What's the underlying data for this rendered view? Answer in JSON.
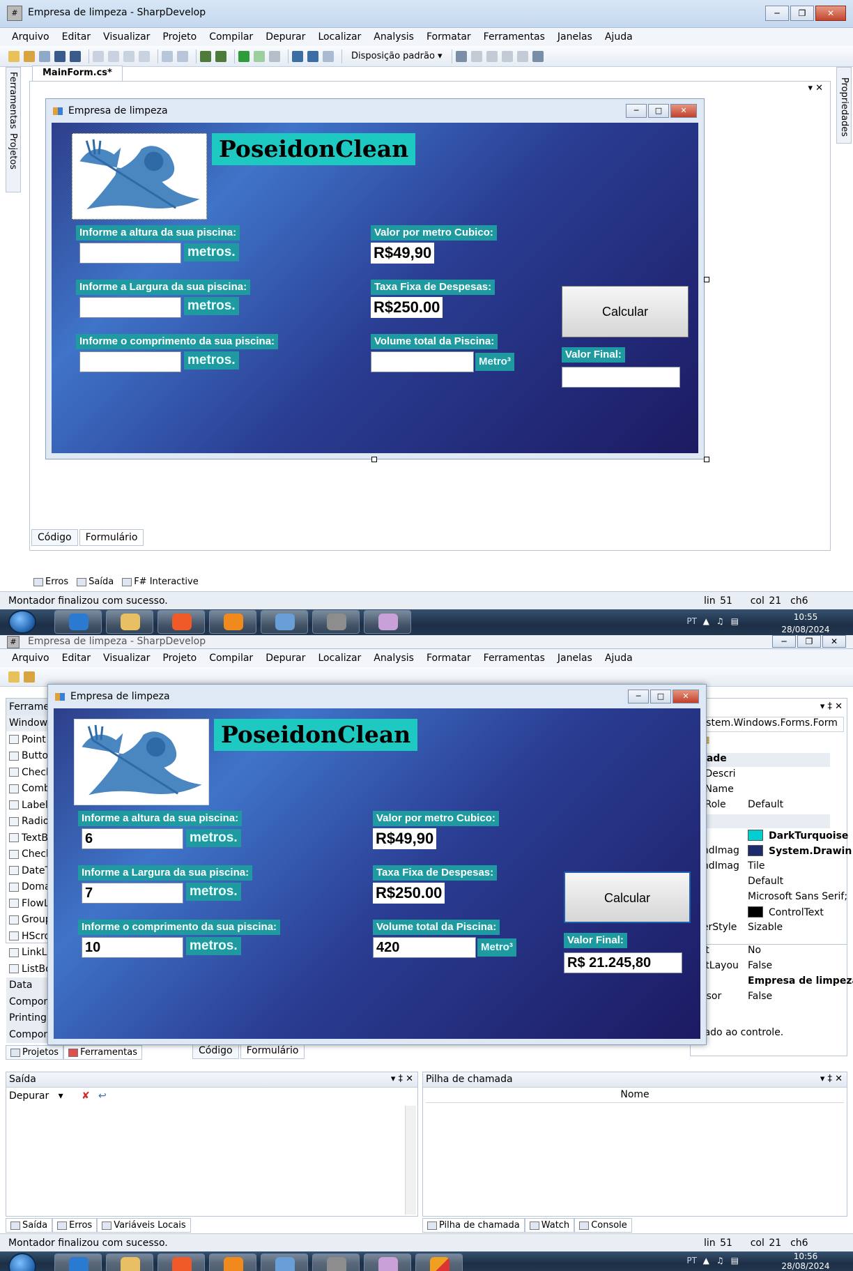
{
  "shot1": {
    "window": {
      "title": "Empresa de limpeza - SharpDevelop",
      "buttons": [
        "minimize",
        "restore",
        "close"
      ]
    },
    "menu": [
      "Arquivo",
      "Editar",
      "Visualizar",
      "Projeto",
      "Compilar",
      "Depurar",
      "Localizar",
      "Analysis",
      "Formatar",
      "Ferramentas",
      "Janelas",
      "Ajuda"
    ],
    "toolbar": {
      "layout_dropdown": "Disposição padrão"
    },
    "side_left": [
      "Ferramentas",
      "Projetos"
    ],
    "side_right": "Propriedades",
    "doc_tab": "MainForm.cs*",
    "designer_tabs": [
      "Código",
      "Formulário"
    ],
    "pad_tabs": [
      "Erros",
      "Saída",
      "F# Interactive"
    ],
    "form": {
      "title": "Empresa de limpeza",
      "brand": "PoseidonClean",
      "label_height": "Informe a altura da sua piscina:",
      "label_width": "Informe a Largura da sua piscina:",
      "label_length": "Informe o comprimento da sua piscina:",
      "unit": "metros.",
      "height_value": "",
      "width_value": "",
      "length_value": "",
      "label_price": "Valor por metro Cubico:",
      "price": "R$49,90",
      "label_fee": "Taxa Fixa de Despesas:",
      "fee": "R$250.00",
      "label_volume": "Volume total da Piscina:",
      "volume_value": "",
      "volume_unit": "Metro³",
      "calc_button": "Calcular",
      "label_final": "Valor Final:",
      "final_value": ""
    },
    "status": {
      "message": "Montador finalizou com sucesso.",
      "line": "lin 51",
      "col": "col 21",
      "ch": "ch6"
    },
    "taskbar": {
      "lang": "PT",
      "time": "10:55",
      "date": "28/08/2024"
    }
  },
  "shot2": {
    "window": {
      "title": "Empresa de limpeza - SharpDevelop"
    },
    "menu": [
      "Arquivo",
      "Editar",
      "Visualizar",
      "Projeto",
      "Compilar",
      "Depurar",
      "Localizar",
      "Analysis",
      "Formatar",
      "Ferramentas",
      "Janelas",
      "Ajuda"
    ],
    "toolbox": {
      "title": "Ferramen",
      "rows": [
        "Window",
        "Point",
        "Butto",
        "Check",
        "Comb",
        "Label",
        "Radio",
        "TextB",
        "Check",
        "DateT",
        "Doma",
        "FlowL",
        "Group",
        "HScro",
        "LinkL",
        "ListBo",
        "Data",
        "Compon",
        "Printing",
        "Compon"
      ]
    },
    "properties": {
      "combo": "System.Windows.Forms.Form",
      "section1": "idade",
      "rows": [
        {
          "n": "leDescri",
          "v": ""
        },
        {
          "n": "leName",
          "v": ""
        },
        {
          "n": "leRole",
          "v": "Default"
        },
        {
          "n": "a",
          "v": ""
        },
        {
          "n": "r",
          "v": "DarkTurquoise"
        },
        {
          "n": "undImag",
          "v": "System.Drawin"
        },
        {
          "n": "undImag",
          "v": "Tile"
        },
        {
          "n": "",
          "v": "Default"
        },
        {
          "n": "",
          "v": "Microsoft Sans Serif;"
        },
        {
          "n": "r",
          "v": "ControlText"
        },
        {
          "n": "derStyle",
          "v": "Sizable"
        },
        {
          "n": "eft",
          "v": "No"
        },
        {
          "n": "eftLayou",
          "v": "False"
        },
        {
          "n": "",
          "v": "Empresa de limpeza"
        },
        {
          "n": "ursor",
          "v": "False"
        }
      ],
      "desc": "ciado ao controle.",
      "colors": {
        "turquoise": "#00ced1",
        "image": "#1e2a6e",
        "controltext": "#000000"
      }
    },
    "left_tabs": [
      "Projetos",
      "Ferramentas"
    ],
    "designer_tabs": [
      "Código",
      "Formulário"
    ],
    "form": {
      "title": "Empresa de limpeza",
      "brand": "PoseidonClean",
      "label_height": "Informe a altura da sua piscina:",
      "label_width": "Informe a Largura da sua piscina:",
      "label_length": "Informe o comprimento da sua piscina:",
      "unit": "metros.",
      "height_value": "6",
      "width_value": "7",
      "length_value": "10",
      "label_price": "Valor por metro Cubico:",
      "price": "R$49,90",
      "label_fee": "Taxa Fixa de Despesas:",
      "fee": "R$250.00",
      "label_volume": "Volume total da Piscina:",
      "volume_value": "420",
      "volume_unit": "Metro³",
      "calc_button": "Calcular",
      "label_final": "Valor Final:",
      "final_value": "R$ 21.245,80"
    },
    "output_pad": {
      "title": "Saída",
      "dropdown": "Depurar"
    },
    "callstack_pad": {
      "title": "Pilha de chamada",
      "column": "Nome"
    },
    "bottom_left_tabs": [
      "Saída",
      "Erros",
      "Variáveis Locais"
    ],
    "bottom_right_tabs": [
      "Pilha de chamada",
      "Watch",
      "Console"
    ],
    "status": {
      "message": "Montador finalizou com sucesso.",
      "line": "lin 51",
      "col": "col 21",
      "ch": "ch6"
    },
    "taskbar": {
      "lang": "PT",
      "time": "10:56",
      "date": "28/08/2024"
    }
  }
}
